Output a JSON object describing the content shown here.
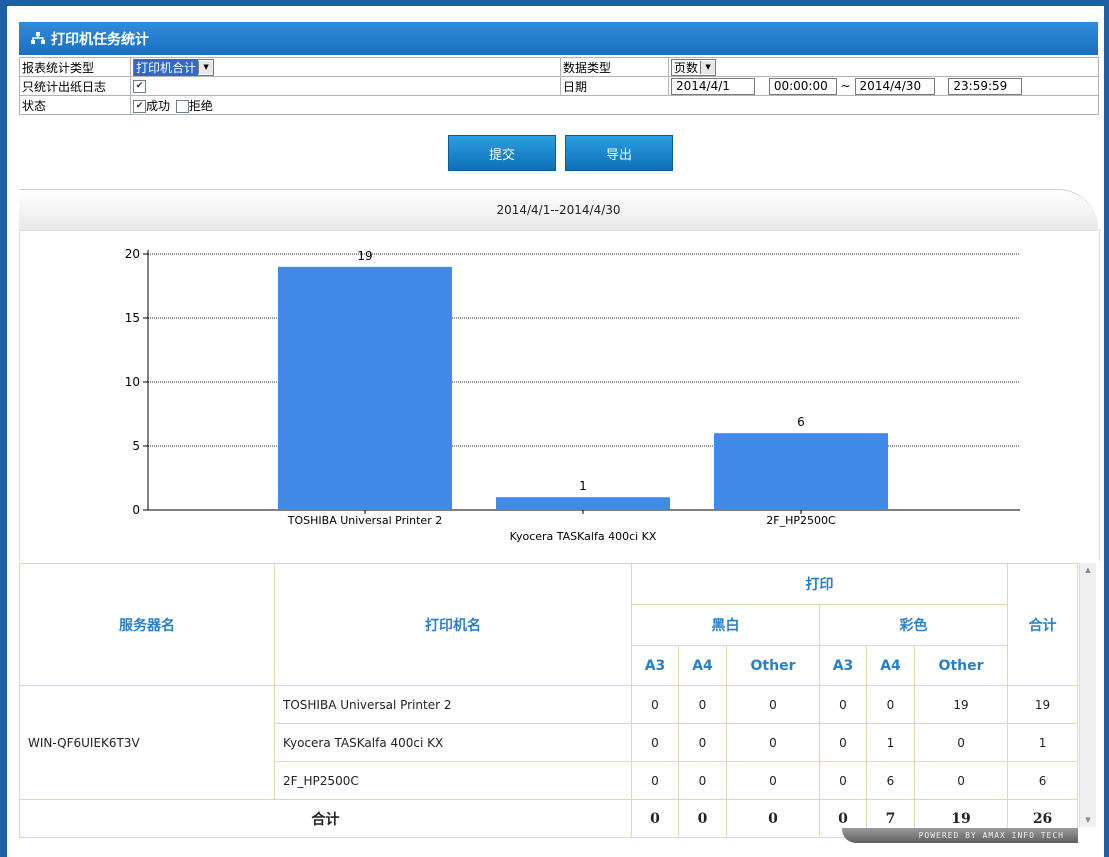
{
  "title": "打印机任务统计",
  "form": {
    "report_type_label": "报表统计类型",
    "report_type_value": "打印机合计",
    "data_type_label": "数据类型",
    "data_type_value": "页数",
    "output_only_label": "只统计出纸日志",
    "output_only_checked": true,
    "date_label": "日期",
    "date_from": "2014/4/1",
    "time_from": "00:00:00",
    "date_sep": "~",
    "date_to": "2014/4/30",
    "time_to": "23:59:59",
    "status_label": "状态",
    "status_success_label": "成功",
    "status_success_checked": true,
    "status_reject_label": "拒绝",
    "status_reject_checked": false
  },
  "buttons": {
    "submit": "提交",
    "export": "导出"
  },
  "chart_header": "2014/4/1--2014/4/30",
  "chart_data": {
    "type": "bar",
    "categories": [
      "TOSHIBA Universal Printer 2",
      "Kyocera TASKalfa 400ci KX",
      "2F_HP2500C"
    ],
    "values": [
      19,
      1,
      6
    ],
    "title": "",
    "xlabel": "",
    "ylabel": "",
    "ylim": [
      0,
      20
    ],
    "yticks": [
      0,
      5,
      10,
      15,
      20
    ],
    "grid": true,
    "color": "#4289e8",
    "legend": "none"
  },
  "table": {
    "h_server": "服务器名",
    "h_printer": "打印机名",
    "h_print": "打印",
    "h_bw": "黑白",
    "h_color": "彩色",
    "h_total": "合计",
    "h_a3": "A3",
    "h_a4": "A4",
    "h_other": "Other",
    "server": "WIN-QF6UIEK6T3V",
    "rows": [
      {
        "printer": "TOSHIBA Universal Printer 2",
        "bw_a3": "0",
        "bw_a4": "0",
        "bw_other": "0",
        "c_a3": "0",
        "c_a4": "0",
        "c_other": "19",
        "total": "19"
      },
      {
        "printer": "Kyocera TASKalfa 400ci KX",
        "bw_a3": "0",
        "bw_a4": "0",
        "bw_other": "0",
        "c_a3": "0",
        "c_a4": "1",
        "c_other": "0",
        "total": "1"
      },
      {
        "printer": "2F_HP2500C",
        "bw_a3": "0",
        "bw_a4": "0",
        "bw_other": "0",
        "c_a3": "0",
        "c_a4": "6",
        "c_other": "0",
        "total": "6"
      }
    ],
    "total_label": "合计",
    "totals": {
      "bw_a3": "0",
      "bw_a4": "0",
      "bw_other": "0",
      "c_a3": "0",
      "c_a4": "7",
      "c_other": "19",
      "total": "26"
    }
  },
  "footer_brand": "POWERED BY AMAX INFO TECH"
}
